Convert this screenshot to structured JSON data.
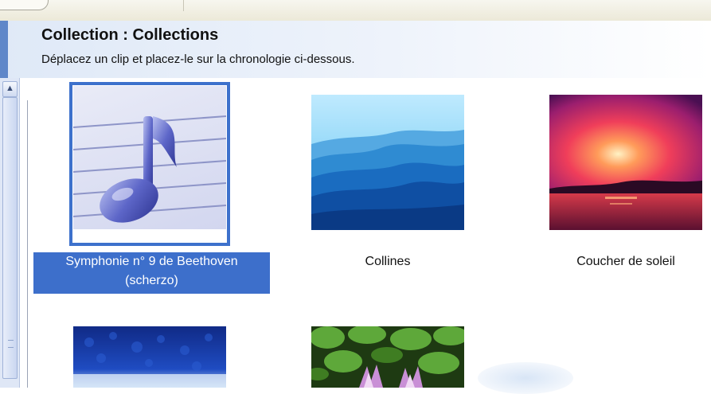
{
  "header": {
    "title": "Collection : Collections",
    "subtitle": "Déplacez un clip et placez-le sur la chronologie ci-dessous."
  },
  "clips": [
    {
      "caption_line1": "Symphonie n° 9 de Beethoven",
      "caption_line2": "(scherzo)",
      "selected": true,
      "icon": "music-note-icon"
    },
    {
      "caption_line1": "Collines",
      "selected": false,
      "icon": "hills-image"
    },
    {
      "caption_line1": "Coucher de soleil",
      "selected": false,
      "icon": "sunset-image"
    },
    {
      "caption_line1": "",
      "selected": false,
      "icon": "blue-texture-image"
    },
    {
      "caption_line1": "",
      "selected": false,
      "icon": "water-lilies-image"
    }
  ],
  "colors": {
    "selection": "#3d6fcb",
    "header_accent": "#5f87c9"
  }
}
